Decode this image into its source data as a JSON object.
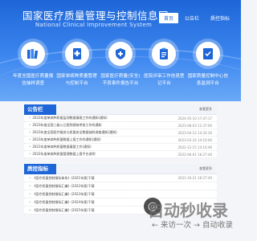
{
  "header": {
    "title": "国家医疗质量管理与控制信息网",
    "subtitle": "National Clinical Improvement System",
    "nav": [
      "首页",
      "公告栏",
      "质控指标"
    ]
  },
  "features": [
    {
      "label": "年度全国医疗质量报告抽样调查",
      "icon": "books-icon"
    },
    {
      "label": "国家单病种质量管理与控制平台",
      "icon": "medical-document-icon"
    },
    {
      "label": "国家医疗质量(安全)不良事件报告平台",
      "icon": "shield-plus-icon"
    },
    {
      "label": "医院评审工作信息登记平台",
      "icon": "clipboard-icon"
    },
    {
      "label": "国家质量控制中心信息监测平台",
      "icon": "monitor-document-icon"
    }
  ],
  "announcements": {
    "tab": "公告栏",
    "more": "查看更多",
    "items": [
      {
        "title": "2022年度单病种质量监测数据填报工作的通知(通知)",
        "date": "2024-05-10 17:47:17"
      },
      {
        "title": "2023年度全国三级公立医院绩效考核工作的通知",
        "date": "2023-08-03 11:37:06"
      },
      {
        "title": "2023年度全国医疗服务与质量安全数据抽样调查通知(通知)",
        "date": "2023-04-12 14:32:26"
      },
      {
        "title": "2023年度单病种质量数据上报工作的通知(通知)",
        "date": "2023-03-24 14:10:06"
      },
      {
        "title": "2021年度单病种质量数据填报工作(通知)",
        "date": "2022-12-15 14:10:46"
      },
      {
        "title": "2022年度单病种质量管理数据上报平台说明",
        "date": "2022-06-01 16:27:40"
      }
    ]
  },
  "indicators": {
    "tab": "质控指标",
    "more": "查看更多",
    "items": [
      {
        "title": "《医疗质量控制指标体系》(2021年版)下载",
        "date": "2021-10-21 16:27:40"
      },
      {
        "title": "《医疗质量控制指标汇编》(2022年版)下载",
        "date": ""
      },
      {
        "title": "《医疗质量控制指标汇编》(2023年版)下载",
        "date": ""
      },
      {
        "title": "《医疗质量控制指标汇编》(2024年版)下载",
        "date": ""
      },
      {
        "title": "《医疗质量控制指标汇编》(2025年版)下载",
        "date": ""
      }
    ]
  },
  "watermark": {
    "main": "自动秒收录",
    "sub": "← 来访一次 → 自动收录"
  }
}
